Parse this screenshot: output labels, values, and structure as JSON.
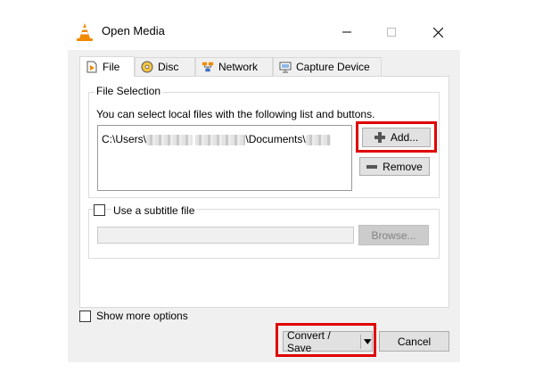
{
  "window": {
    "title": "Open Media",
    "icons": {
      "app": "vlc-cone-icon",
      "minimize": "minimize-icon",
      "maximize": "maximize-icon",
      "close": "close-icon"
    }
  },
  "tabs": [
    {
      "label": "File",
      "icon": "file-play-icon",
      "active": true
    },
    {
      "label": "Disc",
      "icon": "disc-icon",
      "active": false
    },
    {
      "label": "Network",
      "icon": "network-icon",
      "active": false
    },
    {
      "label": "Capture Device",
      "icon": "capture-device-icon",
      "active": false
    }
  ],
  "file_selection": {
    "group_label": "File Selection",
    "instruction": "You can select local files with the following list and buttons.",
    "file_path_start": "C:\\Users\\",
    "file_path_mid": "\\Documents\\",
    "add_label": "Add...",
    "remove_label": "Remove"
  },
  "subtitle": {
    "checkbox_label": "Use a subtitle file",
    "checked": false,
    "browse_label": "Browse..."
  },
  "show_more": {
    "label": "Show more options",
    "checked": false
  },
  "actions": {
    "convert_label": "Convert / Save",
    "cancel_label": "Cancel"
  },
  "highlight_color": "#e00000"
}
